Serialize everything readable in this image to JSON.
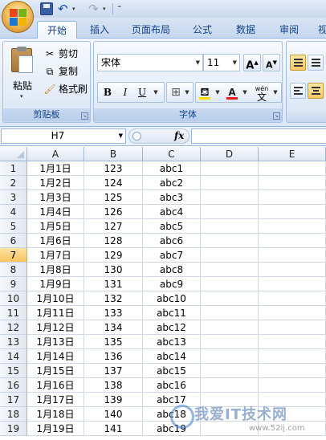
{
  "quick_access": {
    "save": "save-icon",
    "undo": "↶",
    "redo": "↷",
    "dropdown": "▾",
    "customize": "⁼"
  },
  "tabs": [
    "开始",
    "插入",
    "页面布局",
    "公式",
    "数据",
    "审阅",
    "视"
  ],
  "clipboard": {
    "paste": "粘贴",
    "cut": "剪切",
    "copy": "复制",
    "format_painter": "格式刷",
    "label": "剪贴板"
  },
  "font": {
    "name": "宋体",
    "size": "11",
    "grow": "A",
    "shrink": "A",
    "bold": "B",
    "italic": "I",
    "underline": "U",
    "font_color_letter": "A",
    "phonetic": "wén",
    "phonetic_char": "文",
    "label": "字体"
  },
  "formula_bar": {
    "name_box": "H7",
    "fx": "fx",
    "formula": ""
  },
  "colors": {
    "accent": "#15428b",
    "selected_row": "#f7c35f",
    "font_color": "#e02020",
    "fill_color": "#ffe000"
  },
  "sheet": {
    "columns": [
      "A",
      "B",
      "C",
      "D",
      "E"
    ],
    "rows": [
      {
        "num": "1",
        "a": "1月1日",
        "b": "123",
        "c": "abc1"
      },
      {
        "num": "2",
        "a": "1月2日",
        "b": "124",
        "c": "abc2"
      },
      {
        "num": "3",
        "a": "1月3日",
        "b": "125",
        "c": "abc3"
      },
      {
        "num": "4",
        "a": "1月4日",
        "b": "126",
        "c": "abc4"
      },
      {
        "num": "5",
        "a": "1月5日",
        "b": "127",
        "c": "abc5"
      },
      {
        "num": "6",
        "a": "1月6日",
        "b": "128",
        "c": "abc6"
      },
      {
        "num": "7",
        "a": "1月7日",
        "b": "129",
        "c": "abc7"
      },
      {
        "num": "8",
        "a": "1月8日",
        "b": "130",
        "c": "abc8"
      },
      {
        "num": "9",
        "a": "1月9日",
        "b": "131",
        "c": "abc9"
      },
      {
        "num": "10",
        "a": "1月10日",
        "b": "132",
        "c": "abc10"
      },
      {
        "num": "11",
        "a": "1月11日",
        "b": "133",
        "c": "abc11"
      },
      {
        "num": "12",
        "a": "1月12日",
        "b": "134",
        "c": "abc12"
      },
      {
        "num": "13",
        "a": "1月13日",
        "b": "135",
        "c": "abc13"
      },
      {
        "num": "14",
        "a": "1月14日",
        "b": "136",
        "c": "abc14"
      },
      {
        "num": "15",
        "a": "1月15日",
        "b": "137",
        "c": "abc15"
      },
      {
        "num": "16",
        "a": "1月16日",
        "b": "138",
        "c": "abc16"
      },
      {
        "num": "17",
        "a": "1月17日",
        "b": "139",
        "c": "abc17"
      },
      {
        "num": "18",
        "a": "1月18日",
        "b": "140",
        "c": "abc18"
      },
      {
        "num": "19",
        "a": "1月19日",
        "b": "141",
        "c": "abc19"
      }
    ],
    "selected_row": "7"
  },
  "watermark": {
    "text": "我爱IT技术网",
    "url": "www.52ij.com"
  }
}
